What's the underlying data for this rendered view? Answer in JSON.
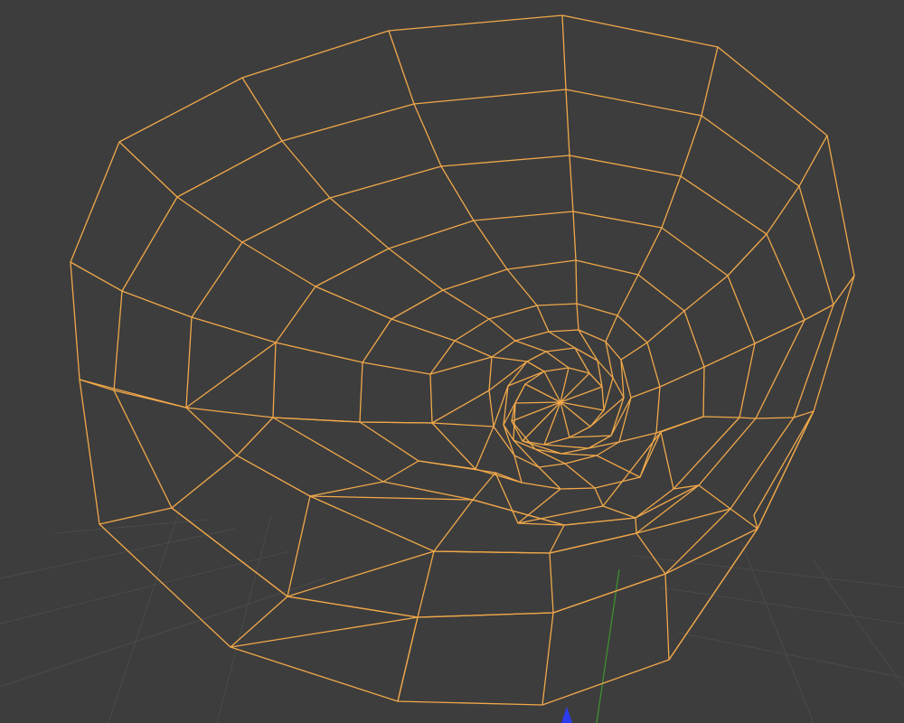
{
  "viewport": {
    "background_color": "#3d3d3d",
    "grid_color": "#4a4a4a",
    "selection_wire_color": "#f0a84a",
    "y_axis_color": "#3f8f2f",
    "z_axis_color": "#2c3cf0",
    "mode": "edit-mesh-wireframe",
    "object_selected": true
  }
}
